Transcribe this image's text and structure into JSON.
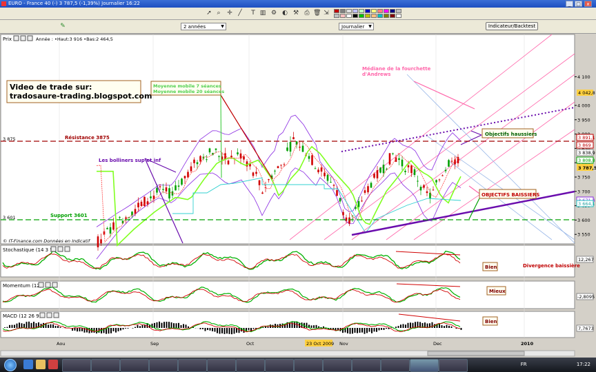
{
  "window": {
    "title": "EURO - France 40 (-)   3 787,5 (-1,39%)   Journalier  16:22",
    "minimize": "_",
    "maximize": "□",
    "close": "x"
  },
  "toolbar": {
    "icons": [
      "cursor-icon",
      "zoom-icon",
      "crosshair-icon",
      "trendline-icon",
      "text-icon",
      "bar-chart-icon",
      "settings-icon",
      "palette-icon",
      "tools-icon",
      "print-icon",
      "delete-icon",
      "extra-icon"
    ],
    "palette_colors": [
      "#c00000",
      "#c0c0c0",
      "#808080",
      "#ffc0c0",
      "#e0e0e0",
      "#ffffff",
      "#c0c0ff",
      "#000000",
      "#c0ffc0",
      "#00c000",
      "#0000c0",
      "#c0c000",
      "#ffff80",
      "#ffc080",
      "#ff8080",
      "#00c0c0",
      "#ff00ff",
      "#808000",
      "#000080",
      "#800000",
      "#c0c0c0",
      "#ffffff"
    ]
  },
  "controls": {
    "period_select": "2 années",
    "interval_select": "Journalier",
    "indicator_button": "Indicateur/Backtest"
  },
  "price_panel": {
    "label": "Prix",
    "info": "Année : •Haut:3 916  •Bas:2 464,5",
    "copyright": "© IT-Finance.com   Données en Indicatif",
    "y_ticks": [
      "4 100",
      "4 000",
      "3 950",
      "3 900",
      "3 850",
      "3 800",
      "3 750",
      "3 700",
      "3 650",
      "3 600",
      "3 550"
    ],
    "price_tags": {
      "last": "3 787,5",
      "t1": "4 042,8",
      "t2": "3 891,1",
      "t3": "3 869",
      "t4": "3 838,9",
      "t5": "3 808,8",
      "t6": "3 671,4",
      "t7": "3 664,1"
    },
    "resistance_label": "Résistance 3875",
    "resistance_value": "3 875",
    "support_label": "Support 3601",
    "support_value": "3 601",
    "annotations": {
      "video_line1": "Video de trade sur:",
      "video_line2": "tradosaure-trading.blogspot.com",
      "ma_line1": "Moyenne mobile 7 séances",
      "ma_line2": "Moyenne mobile 20 séances",
      "bollinger": "Les bolliners sup et inf",
      "median_line1": "Médiane de la fourchette",
      "median_line2": "d'Andrews",
      "objectifs_up": "Objectifs haussiers",
      "objectifs_down": "OBJECTIFS BAISSIERS"
    }
  },
  "stoch_panel": {
    "label": "Stochastique (14 3 5)",
    "value_tag": "12,267",
    "note": "Bien",
    "divergence": "Divergence baissière"
  },
  "momentum_panel": {
    "label": "Momentum (12)",
    "value_tag": "-2,8095",
    "note": "Mieux"
  },
  "macd_panel": {
    "label": "MACD (12 26 9)",
    "value_tag": "7,7673",
    "note": "Bien"
  },
  "x_axis": {
    "labels": [
      "Aou",
      "Sep",
      "Oct",
      "Nov",
      "Dec",
      "2010"
    ],
    "highlight": "23 Oct 2009"
  },
  "taskbar": {
    "lang": "FR",
    "clock": "17:22"
  },
  "colors": {
    "price_up": "#00a000",
    "price_down": "#d00000",
    "bollinger": "#8a2be2",
    "ma7": "#ff4040",
    "ma20": "#80ff20",
    "resistance": "#a00000",
    "support": "#00a000",
    "andrews": "#ff66aa",
    "support_line": "#6a0dad"
  }
}
